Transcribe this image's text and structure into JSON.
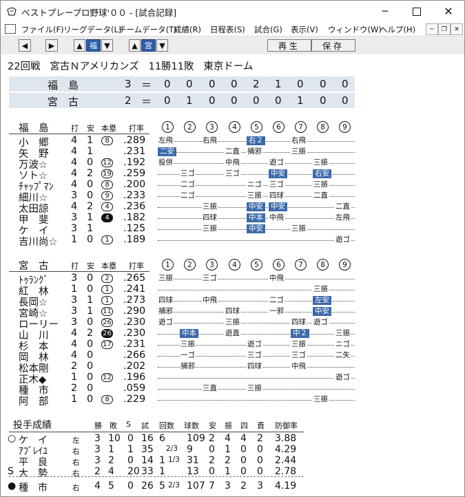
{
  "window": {
    "title": "ベストプレープロ野球'００ - [試合記録]"
  },
  "menu": [
    "ファイル(F)",
    "リーグデータ(L)",
    "チームデータ(T)",
    "成績(R)",
    "日程表(S)",
    "試合(G)",
    "表示(V)",
    "ウィンドウ(W)",
    "ヘルプ(H)"
  ],
  "toolbar": {
    "team1": "福",
    "team2": "宮",
    "replay": "再生",
    "save": "保存"
  },
  "game": {
    "number": "22回戦",
    "team": "宮古Ｎアメリカンズ",
    "record": "11勝11敗",
    "venue": "東京ドーム"
  },
  "scoreboard": [
    {
      "team": "福　島",
      "runs": "3",
      "innings": [
        "0",
        "0",
        "0",
        "0",
        "2",
        "1",
        "0",
        "0",
        "0"
      ]
    },
    {
      "team": "宮　古",
      "runs": "2",
      "innings": [
        "0",
        "1",
        "0",
        "0",
        "0",
        "0",
        "1",
        "0",
        "0"
      ]
    }
  ],
  "columns": {
    "ab": "打",
    "hit": "安",
    "hr": "本塁",
    "avg": "打率"
  },
  "innings_labels": [
    "1",
    "2",
    "3",
    "4",
    "5",
    "6",
    "7",
    "8",
    "9"
  ],
  "fukushima": {
    "team": "福　島",
    "players": [
      {
        "name": "小　郷",
        "ab": "4",
        "h": "1",
        "hr": "8",
        "blk": false,
        "avg": ".289",
        "res": {
          "0": [
            "左飛",
            false
          ],
          "2": [
            "右飛",
            false
          ],
          "4": [
            "右２",
            true
          ],
          "6": [
            "右飛",
            false
          ]
        }
      },
      {
        "name": "矢　野",
        "ab": "4",
        "h": "1",
        "hr": "",
        "blk": false,
        "avg": ".231",
        "res": {
          "0": [
            "二安",
            true
          ],
          "3": [
            "二直",
            false
          ],
          "4": [
            "捕邪",
            false
          ],
          "6": [
            "三振",
            false
          ]
        }
      },
      {
        "name": "万波☆",
        "ab": "4",
        "h": "0",
        "hr": "12",
        "blk": false,
        "avg": ".192",
        "res": {
          "0": [
            "投併",
            false
          ],
          "3": [
            "中飛",
            false
          ],
          "5": [
            "遊ゴ",
            false
          ],
          "7": [
            "三振",
            false
          ]
        }
      },
      {
        "name": "ソト☆",
        "ab": "4",
        "h": "2",
        "hr": "19",
        "blk": false,
        "avg": ".259",
        "res": {
          "1": [
            "三ゴ",
            false
          ],
          "3": [
            "三ゴ",
            false
          ],
          "5": [
            "中安",
            true
          ],
          "7": [
            "右安",
            true
          ]
        }
      },
      {
        "name": "ﾁｬｯﾌﾟﾏﾝ",
        "ab": "4",
        "h": "0",
        "hr": "8",
        "blk": false,
        "avg": ".200",
        "res": {
          "1": [
            "二ゴ",
            false
          ],
          "4": [
            "ニゴ",
            false
          ],
          "5": [
            "三ゴ",
            false
          ],
          "7": [
            "三振",
            false
          ]
        }
      },
      {
        "name": "細川☆",
        "ab": "3",
        "h": "0",
        "hr": "9",
        "blk": false,
        "avg": ".233",
        "res": {
          "1": [
            "二ゴ",
            false
          ],
          "4": [
            "三振",
            false
          ],
          "5": [
            "四球",
            false
          ],
          "7": [
            "二直",
            false
          ]
        }
      },
      {
        "name": "太田諒",
        "ab": "4",
        "h": "2",
        "hr": "4",
        "blk": false,
        "avg": ".236",
        "res": {
          "2": [
            "三振",
            false
          ],
          "4": [
            "中安",
            true
          ],
          "5": [
            "中安",
            true
          ],
          "8": [
            "二直",
            false
          ]
        }
      },
      {
        "name": "甲　斐",
        "ab": "3",
        "h": "1",
        "hr": "4",
        "blk": true,
        "avg": ".182",
        "res": {
          "2": [
            "四球",
            false
          ],
          "4": [
            "中本",
            true
          ],
          "5": [
            "中飛",
            false
          ],
          "8": [
            "左飛",
            false
          ]
        }
      },
      {
        "name": "ケ　イ",
        "ab": "3",
        "h": "1",
        "hr": "",
        "blk": false,
        "avg": ".125",
        "res": {
          "2": [
            "三振",
            false
          ],
          "4": [
            "中安",
            true
          ],
          "6": [
            "三振",
            false
          ]
        }
      },
      {
        "name": "吉川尚☆",
        "ab": "1",
        "h": "0",
        "hr": "1",
        "blk": false,
        "avg": ".189",
        "res": {
          "8": [
            "遊ゴ",
            false
          ]
        }
      }
    ]
  },
  "miyako": {
    "team": "宮　古",
    "players": [
      {
        "name": "ﾄｩﾗﾝｸﾞ",
        "ab": "3",
        "h": "0",
        "hr": "2",
        "blk": false,
        "avg": ".265",
        "res": {
          "0": [
            "三振",
            false
          ],
          "2": [
            "三ゴ",
            false
          ],
          "5": [
            "中飛",
            false
          ]
        }
      },
      {
        "name": "紅　林",
        "ab": "1",
        "h": "0",
        "hr": "1",
        "blk": false,
        "avg": ".241",
        "res": {
          "7": [
            "三振",
            false
          ]
        }
      },
      {
        "name": "長岡☆",
        "ab": "3",
        "h": "1",
        "hr": "1",
        "blk": false,
        "avg": ".273",
        "res": {
          "0": [
            "四球",
            false
          ],
          "2": [
            "中飛",
            false
          ],
          "5": [
            "二ゴ",
            false
          ],
          "7": [
            "左安",
            true
          ]
        }
      },
      {
        "name": "宮崎☆",
        "ab": "3",
        "h": "1",
        "hr": "11",
        "blk": false,
        "avg": ".290",
        "res": {
          "0": [
            "捕邪",
            false
          ],
          "3": [
            "四球",
            false
          ],
          "5": [
            "一邪",
            false
          ],
          "7": [
            "中安",
            true
          ]
        }
      },
      {
        "name": "ローリー",
        "ab": "3",
        "h": "0",
        "hr": "26",
        "blk": false,
        "avg": ".230",
        "res": {
          "0": [
            "遊ゴ",
            false
          ],
          "3": [
            "三振",
            false
          ],
          "6": [
            "四球",
            false
          ],
          "7": [
            "遊ゴ",
            false
          ]
        }
      },
      {
        "name": "山　川",
        "ab": "4",
        "h": "2",
        "hr": "26",
        "blk": true,
        "avg": ".230",
        "res": {
          "1": [
            "中本",
            true
          ],
          "3": [
            "遊直",
            false
          ],
          "6": [
            "中２",
            true
          ],
          "8": [
            "三振",
            false
          ]
        }
      },
      {
        "name": "杉　本",
        "ab": "4",
        "h": "0",
        "hr": "17",
        "blk": false,
        "avg": ".231",
        "res": {
          "1": [
            "三振",
            false
          ],
          "4": [
            "遊ゴ",
            false
          ],
          "6": [
            "三振",
            false
          ],
          "8": [
            "ニゴ",
            false
          ]
        }
      },
      {
        "name": "岡　林",
        "ab": "4",
        "h": "0",
        "hr": "",
        "blk": false,
        "avg": ".266",
        "res": {
          "1": [
            "一ゴ",
            false
          ],
          "4": [
            "三ゴ",
            false
          ],
          "6": [
            "三ゴ",
            false
          ],
          "8": [
            "二失",
            false
          ]
        }
      },
      {
        "name": "松本剛",
        "ab": "2",
        "h": "0",
        "hr": "",
        "blk": false,
        "avg": ".202",
        "res": {
          "1": [
            "捕邪",
            false
          ],
          "4": [
            "四球",
            false
          ],
          "6": [
            "中飛",
            false
          ]
        }
      },
      {
        "name": "正木◆",
        "ab": "1",
        "h": "0",
        "hr": "12",
        "blk": false,
        "avg": ".196",
        "res": {
          "8": [
            "遊ゴ",
            false
          ]
        }
      },
      {
        "name": "種　市",
        "ab": "2",
        "h": "0",
        "hr": "",
        "blk": false,
        "avg": ".059",
        "res": {
          "2": [
            "三直",
            false
          ],
          "4": [
            "三振",
            false
          ]
        }
      },
      {
        "name": "阿　部",
        "ab": "1",
        "h": "0",
        "hr": "8",
        "blk": false,
        "avg": ".229",
        "res": {
          "7": [
            "三振",
            false
          ]
        }
      }
    ]
  },
  "pitching": {
    "title": "投手成績",
    "headers": [
      "勝",
      "敗",
      "S",
      "試",
      "回数",
      "球数",
      "安",
      "振",
      "四",
      "責",
      "防御率"
    ],
    "pitchers": [
      {
        "mark": "○",
        "name": "ケ　イ",
        "hand": "左",
        "w": "3",
        "l": "10",
        "s": "0",
        "g": "16",
        "ip": "6",
        "ipf": "",
        "bp": "109",
        "h": "2",
        "k": "4",
        "bb": "4",
        "er": "2",
        "era": "3.88"
      },
      {
        "mark": "",
        "name": "ｱﾌﾞﾚｲﾕ",
        "hand": "右",
        "w": "3",
        "l": "1",
        "s": "1",
        "g": "35",
        "ip": "",
        "ipf": "2/3",
        "bp": "9",
        "h": "0",
        "k": "1",
        "bb": "0",
        "er": "0",
        "era": "4.29"
      },
      {
        "mark": "",
        "name": "平　良",
        "hand": "右",
        "w": "3",
        "l": "2",
        "s": "0",
        "g": "14",
        "ip": "1",
        "ipf": "1/3",
        "bp": "31",
        "h": "2",
        "k": "2",
        "bb": "0",
        "er": "0",
        "era": "2.44"
      },
      {
        "mark": "S",
        "name": "大　勢",
        "hand": "右",
        "w": "2",
        "l": "4",
        "s": "20",
        "g": "33",
        "ip": "1",
        "ipf": "",
        "bp": "13",
        "h": "0",
        "k": "1",
        "bb": "0",
        "er": "0",
        "era": "2.78"
      },
      {
        "mark": "●",
        "name": "種　市",
        "hand": "右",
        "w": "4",
        "l": "5",
        "s": "0",
        "g": "26",
        "ip": "5",
        "ipf": "2/3",
        "bp": "107",
        "h": "7",
        "k": "3",
        "bb": "2",
        "er": "3",
        "era": "4.19"
      }
    ]
  }
}
